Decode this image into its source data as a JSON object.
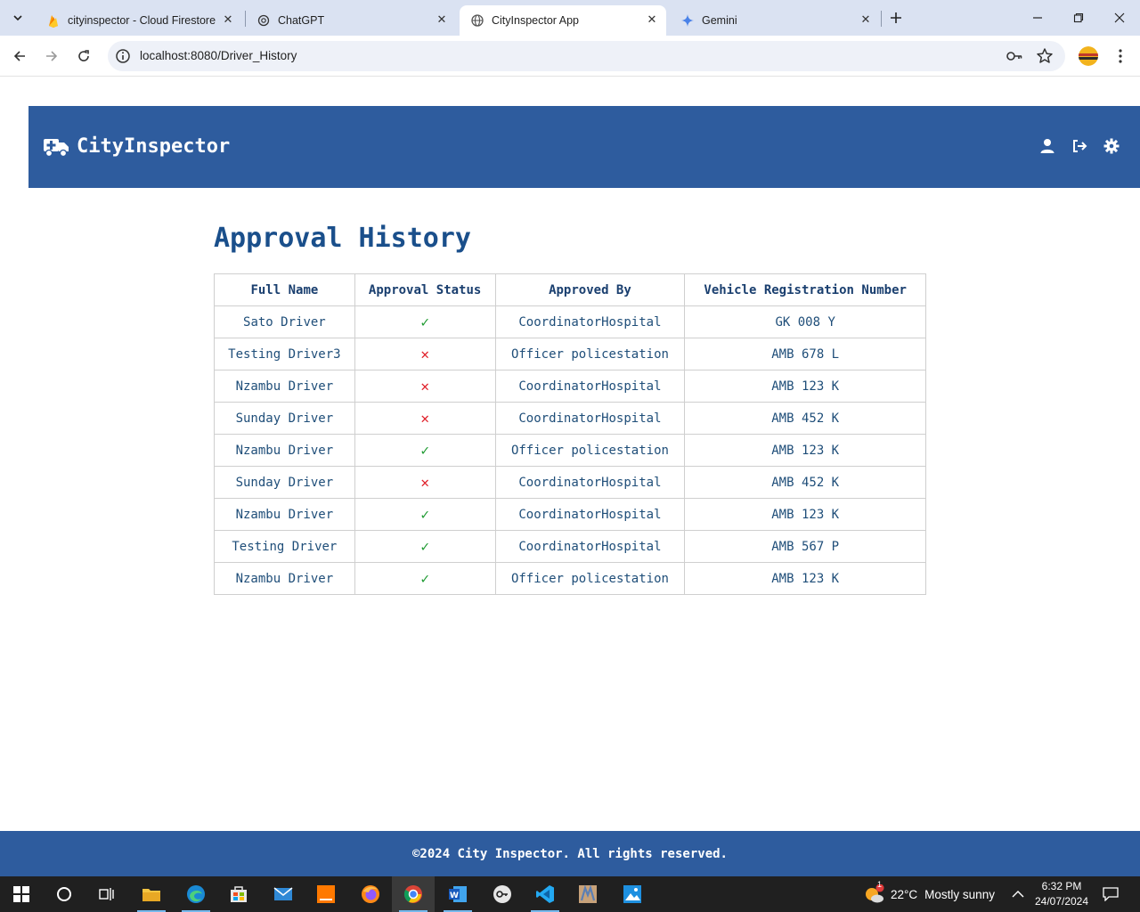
{
  "browser": {
    "tabs": [
      {
        "title": "cityinspector - Cloud Firestore",
        "icon": "firebase-icon"
      },
      {
        "title": "ChatGPT",
        "icon": "chatgpt-icon"
      },
      {
        "title": "CityInspector App",
        "icon": "globe-icon"
      },
      {
        "title": "Gemini",
        "icon": "gemini-icon"
      }
    ],
    "url": "localhost:8080/Driver_History"
  },
  "app": {
    "brand": "CityInspector",
    "header_icons": [
      "user-icon",
      "sign-out-icon",
      "settings-gear-icon"
    ],
    "page_title": "Approval History",
    "table": {
      "headers": [
        "Full Name",
        "Approval Status",
        "Approved By",
        "Vehicle Registration Number"
      ],
      "rows": [
        {
          "name": "Sato Driver",
          "status": "approved",
          "approved_by": "CoordinatorHospital",
          "vehicle": "GK 008 Y"
        },
        {
          "name": "Testing Driver3",
          "status": "rejected",
          "approved_by": "Officer policestation",
          "vehicle": "AMB 678 L"
        },
        {
          "name": "Nzambu Driver",
          "status": "rejected",
          "approved_by": "CoordinatorHospital",
          "vehicle": "AMB 123 K"
        },
        {
          "name": "Sunday Driver",
          "status": "rejected",
          "approved_by": "CoordinatorHospital",
          "vehicle": "AMB 452 K"
        },
        {
          "name": "Nzambu Driver",
          "status": "approved",
          "approved_by": "Officer policestation",
          "vehicle": "AMB 123 K"
        },
        {
          "name": "Sunday Driver",
          "status": "rejected",
          "approved_by": "CoordinatorHospital",
          "vehicle": "AMB 452 K"
        },
        {
          "name": "Nzambu Driver",
          "status": "approved",
          "approved_by": "CoordinatorHospital",
          "vehicle": "AMB 123 K"
        },
        {
          "name": "Testing Driver",
          "status": "approved",
          "approved_by": "CoordinatorHospital",
          "vehicle": "AMB 567 P"
        },
        {
          "name": "Nzambu Driver",
          "status": "approved",
          "approved_by": "Officer policestation",
          "vehicle": "AMB 123 K"
        }
      ],
      "status_symbols": {
        "approved": "✓",
        "rejected": "✕"
      }
    },
    "footer": "©2024 City Inspector. All rights reserved."
  },
  "taskbar": {
    "weather_temp": "22°C",
    "weather_text": "Mostly sunny",
    "weather_badge": "1",
    "time": "6:32 PM",
    "date": "24/07/2024"
  },
  "colors": {
    "header_bg": "#2e5c9e",
    "title": "#1a4f8b",
    "approved": "#1e9a31",
    "rejected": "#e0202a"
  }
}
